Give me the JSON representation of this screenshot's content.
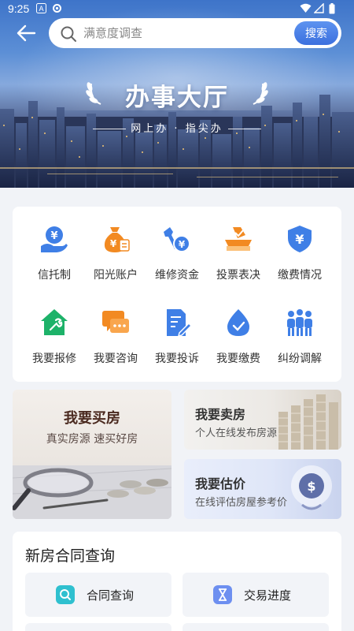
{
  "status_bar": {
    "time": "9:25"
  },
  "search": {
    "placeholder": "满意度调查",
    "button_label": "搜索"
  },
  "hero": {
    "title": "办事大厅",
    "subtitle": "网上办 · 指尖办"
  },
  "services": [
    {
      "label": "信托制",
      "icon": "hand-coin-icon"
    },
    {
      "label": "阳光账户",
      "icon": "money-bag-icon"
    },
    {
      "label": "维修资金",
      "icon": "wrench-coin-icon"
    },
    {
      "label": "投票表决",
      "icon": "ballot-box-icon"
    },
    {
      "label": "缴费情况",
      "icon": "shield-yen-icon"
    },
    {
      "label": "我要报修",
      "icon": "house-repair-icon"
    },
    {
      "label": "我要咨询",
      "icon": "chat-bubbles-icon"
    },
    {
      "label": "我要投诉",
      "icon": "document-edit-icon"
    },
    {
      "label": "我要缴费",
      "icon": "water-drop-icon"
    },
    {
      "label": "纠纷调解",
      "icon": "people-group-icon"
    }
  ],
  "promo": {
    "buy": {
      "title": "我要买房",
      "desc": "真实房源 速买好房"
    },
    "sell": {
      "title": "我要卖房",
      "desc": "个人在线发布房源"
    },
    "evaluate": {
      "title": "我要估价",
      "desc": "在线评估房屋参考价"
    }
  },
  "contract": {
    "title": "新房合同查询",
    "buttons": [
      {
        "label": "合同查询",
        "icon": "contract-search-icon"
      },
      {
        "label": "交易进度",
        "icon": "hourglass-icon"
      }
    ]
  },
  "colors": {
    "accent": "#3f7fe6",
    "orange": "#f28a22",
    "green": "#1db269"
  }
}
